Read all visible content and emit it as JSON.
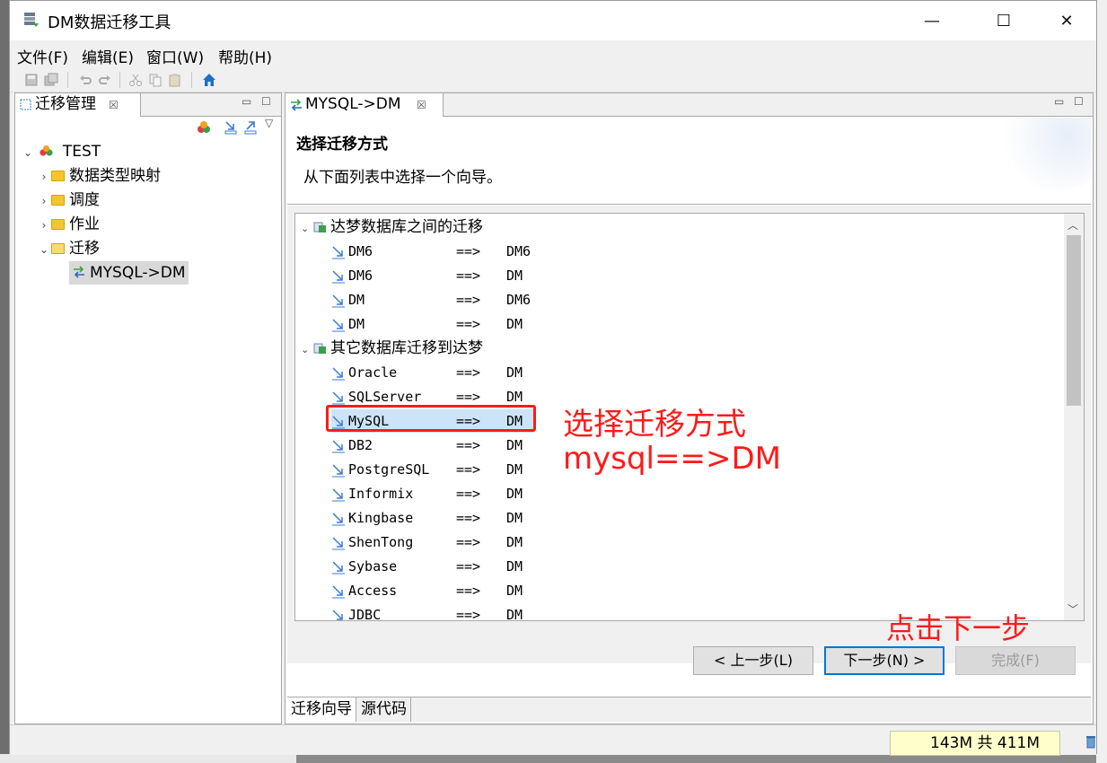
{
  "window": {
    "title": "DM数据迁移工具",
    "minimize": "—",
    "maximize": "☐",
    "close": "✕"
  },
  "menu": [
    "文件(F)",
    "编辑(E)",
    "窗口(W)",
    "帮助(H)"
  ],
  "left_panel": {
    "tab_label": "迁移管理",
    "tree": {
      "root": "TEST",
      "children": [
        "数据类型映射",
        "调度",
        "作业",
        "迁移"
      ],
      "selected": "MYSQL->DM"
    }
  },
  "editor": {
    "tab_label": "MYSQL->DM",
    "wizard_title": "选择迁移方式",
    "wizard_desc": "从下面列表中选择一个向导。",
    "groups": [
      {
        "label": "达梦数据库之间的迁移",
        "rows": [
          {
            "src": "DM6",
            "arrow": "==>",
            "dst": "DM6"
          },
          {
            "src": "DM6",
            "arrow": "==>",
            "dst": "DM"
          },
          {
            "src": "DM",
            "arrow": "==>",
            "dst": "DM6"
          },
          {
            "src": "DM",
            "arrow": "==>",
            "dst": "DM"
          }
        ]
      },
      {
        "label": "其它数据库迁移到达梦",
        "rows": [
          {
            "src": "Oracle",
            "arrow": "==>",
            "dst": "DM"
          },
          {
            "src": "SQLServer",
            "arrow": "==>",
            "dst": "DM"
          },
          {
            "src": "MySQL",
            "arrow": "==>",
            "dst": "DM",
            "selected": true
          },
          {
            "src": "DB2",
            "arrow": "==>",
            "dst": "DM"
          },
          {
            "src": "PostgreSQL",
            "arrow": "==>",
            "dst": "DM"
          },
          {
            "src": "Informix",
            "arrow": "==>",
            "dst": "DM"
          },
          {
            "src": "Kingbase",
            "arrow": "==>",
            "dst": "DM"
          },
          {
            "src": "ShenTong",
            "arrow": "==>",
            "dst": "DM"
          },
          {
            "src": "Sybase",
            "arrow": "==>",
            "dst": "DM"
          },
          {
            "src": "Access",
            "arrow": "==>",
            "dst": "DM"
          },
          {
            "src": "JDBC",
            "arrow": "==>",
            "dst": "DM"
          }
        ]
      }
    ],
    "buttons": {
      "back": "< 上一步(L)",
      "next": "下一步(N) >",
      "finish": "完成(F)"
    },
    "bottom_tabs": [
      "迁移向导",
      "源代码"
    ]
  },
  "annotations": {
    "line1": "选择迁移方式",
    "line2": "mysql==>DM",
    "next_hint": "点击下一步",
    "color": "#ff1a1a"
  },
  "status": {
    "memory": "143M 共 411M"
  },
  "colors": {
    "selection": "#cce4f7",
    "default_button_border": "#0078d7",
    "folder": "#f3c630"
  }
}
